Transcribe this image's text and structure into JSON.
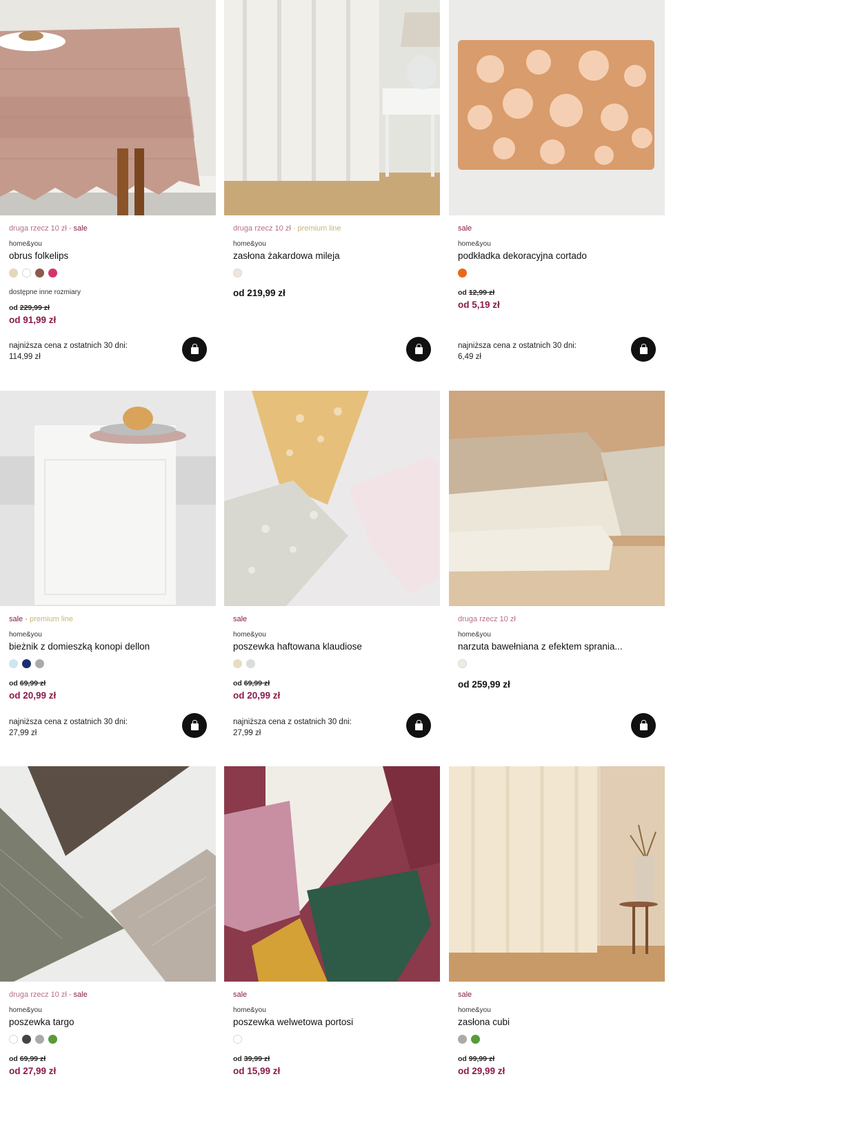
{
  "products": [
    {
      "tags": [
        {
          "text": "druga rzecz 10 zł",
          "type": "second"
        },
        {
          "text": "sale",
          "type": "sale"
        }
      ],
      "brand": "home&you",
      "name": "obrus folkelips",
      "swatches": [
        "#e6d7b8",
        "#ffffff",
        "#8b5a4a",
        "#d6336c"
      ],
      "sizes_note": "dostępne inne rozmiary",
      "old_price_prefix": "od",
      "old_price": "229,99 zł",
      "new_price": "od 91,99 zł",
      "lowest_label": "najniższa cena z ostatnich 30 dni:",
      "lowest_value": "114,99 zł",
      "image_icon": "tablecloth-image"
    },
    {
      "tags": [
        {
          "text": "druga rzecz 10 zł",
          "type": "second"
        },
        {
          "text": "premium line",
          "type": "premium"
        }
      ],
      "brand": "home&you",
      "name": "zasłona żakardowa mileja",
      "swatches": [
        "#efe6da"
      ],
      "price": "od 219,99 zł",
      "image_icon": "curtain-image"
    },
    {
      "tags": [
        {
          "text": "sale",
          "type": "sale"
        }
      ],
      "brand": "home&you",
      "name": "podkładka dekoracyjna cortado",
      "swatches": [
        "#e8681a"
      ],
      "old_price_prefix": "od",
      "old_price": "12,99 zł",
      "new_price": "od 5,19 zł",
      "lowest_label": "najniższa cena z ostatnich 30 dni:",
      "lowest_value": "6,49 zł",
      "image_icon": "placemat-image"
    },
    {
      "tags": [
        {
          "text": "sale",
          "type": "sale"
        },
        {
          "text": "premium line",
          "type": "premium"
        }
      ],
      "brand": "home&you",
      "name": "bieżnik z domieszką konopi dellon",
      "swatches": [
        "#cde6ef",
        "#1c2f6e",
        "#aaaaaa"
      ],
      "old_price_prefix": "od",
      "old_price": "69,99 zł",
      "new_price": "od 20,99 zł",
      "lowest_label": "najniższa cena z ostatnich 30 dni:",
      "lowest_value": "27,99 zł",
      "image_icon": "table-runner-image"
    },
    {
      "tags": [
        {
          "text": "sale",
          "type": "sale"
        }
      ],
      "brand": "home&you",
      "name": "poszewka haftowana klaudiose",
      "swatches": [
        "#e8dcc4",
        "#dcdcdc"
      ],
      "old_price_prefix": "od",
      "old_price": "69,99 zł",
      "new_price": "od 20,99 zł",
      "lowest_label": "najniższa cena z ostatnich 30 dni:",
      "lowest_value": "27,99 zł",
      "image_icon": "pillowcase-image"
    },
    {
      "tags": [
        {
          "text": "druga rzecz 10 zł",
          "type": "second"
        }
      ],
      "brand": "home&you",
      "name": "narzuta bawełniana z efektem sprania...",
      "swatches": [
        "#f0ebe2"
      ],
      "price": "od 259,99 zł",
      "image_icon": "bedspread-image"
    },
    {
      "tags": [
        {
          "text": "druga rzecz 10 zł",
          "type": "second"
        },
        {
          "text": "sale",
          "type": "sale"
        }
      ],
      "brand": "home&you",
      "name": "poszewka targo",
      "swatches": [
        "#ffffff",
        "#444444",
        "#aaaaaa",
        "#5a9a3a"
      ],
      "old_price_prefix": "od",
      "old_price": "69,99 zł",
      "new_price": "od 27,99 zł",
      "image_icon": "pillowcase-image"
    },
    {
      "tags": [
        {
          "text": "sale",
          "type": "sale"
        }
      ],
      "brand": "home&you",
      "name": "poszewka welwetowa portosi",
      "swatches": [
        "#ffffff"
      ],
      "old_price_prefix": "od",
      "old_price": "39,99 zł",
      "new_price": "od 15,99 zł",
      "image_icon": "velvet-pillowcase-image"
    },
    {
      "tags": [
        {
          "text": "sale",
          "type": "sale"
        }
      ],
      "brand": "home&you",
      "name": "zasłona cubi",
      "swatches": [
        "#aaaaaa",
        "#5a9a3a"
      ],
      "old_price_prefix": "od",
      "old_price": "99,99 zł",
      "new_price": "od 29,99 zł",
      "image_icon": "curtain-image"
    }
  ]
}
